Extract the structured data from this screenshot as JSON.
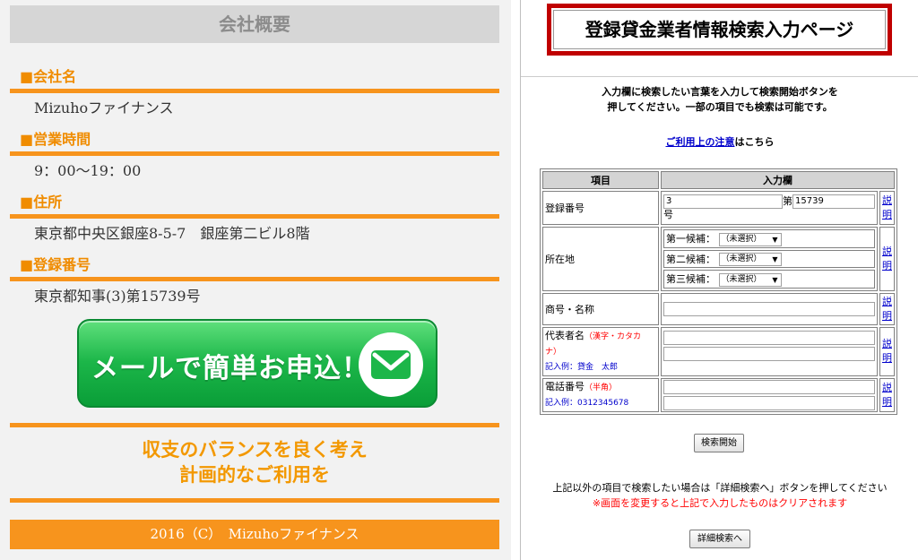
{
  "left": {
    "header": "会社概要",
    "sections": [
      {
        "title": "■会社名",
        "value": "Mizuhoファイナンス"
      },
      {
        "title": "■営業時間",
        "value": "9：00〜19：00"
      },
      {
        "title": "■住所",
        "value": "東京都中央区銀座8-5-7　銀座第二ビル8階"
      },
      {
        "title": "■登録番号",
        "value": "東京都知事(3)第15739号"
      }
    ],
    "cta_label": "メールで簡単お申込！",
    "slogan_line1": "収支のバランスを良く考え",
    "slogan_line2": "計画的なご利用を",
    "footer": "2016（C）　Mizuhoファイナンス",
    "colors": {
      "accent": "#f7941d",
      "cta_green": "#1cb649"
    }
  },
  "right": {
    "title": "登録貸金業者情報検索入力ページ",
    "instruction_line1": "入力欄に検索したい言葉を入力して検索開始ボタンを",
    "instruction_line2": "押してください。一部の項目でも検索は可能です。",
    "notice_link": "ご利用上の注意",
    "notice_suffix": "はこちら",
    "table": {
      "col_item": "項目",
      "col_input": "入力欄",
      "reg_label": "登録番号",
      "reg_value1": "3",
      "reg_mid": "第",
      "reg_value2": "15739",
      "reg_suffix": "号",
      "loc_label": "所在地",
      "loc_options": [
        {
          "label": "第一候補：",
          "selected": "（未選択）"
        },
        {
          "label": "第二候補：",
          "selected": "（未選択）"
        },
        {
          "label": "第三候補：",
          "selected": "（未選択）"
        }
      ],
      "name_label": "商号・名称",
      "rep_label": "代表者名",
      "rep_note": "（漢字・カタカナ）",
      "rep_example": "記入例：貸金　太郎",
      "tel_label": "電話番号",
      "tel_note": "（半角）",
      "tel_example": "記入例：0312345678",
      "help_label": "説明"
    },
    "search_button": "検索開始",
    "other_note": "上記以外の項目で検索したい場合は「詳細検索へ」ボタンを押してください",
    "warning": "※画面を変更すると上記で入力したものはクリアされます",
    "detail_button": "詳細検索へ",
    "colors": {
      "title_border": "#c00000",
      "link": "#0000cc",
      "warning": "#ff0000"
    }
  }
}
